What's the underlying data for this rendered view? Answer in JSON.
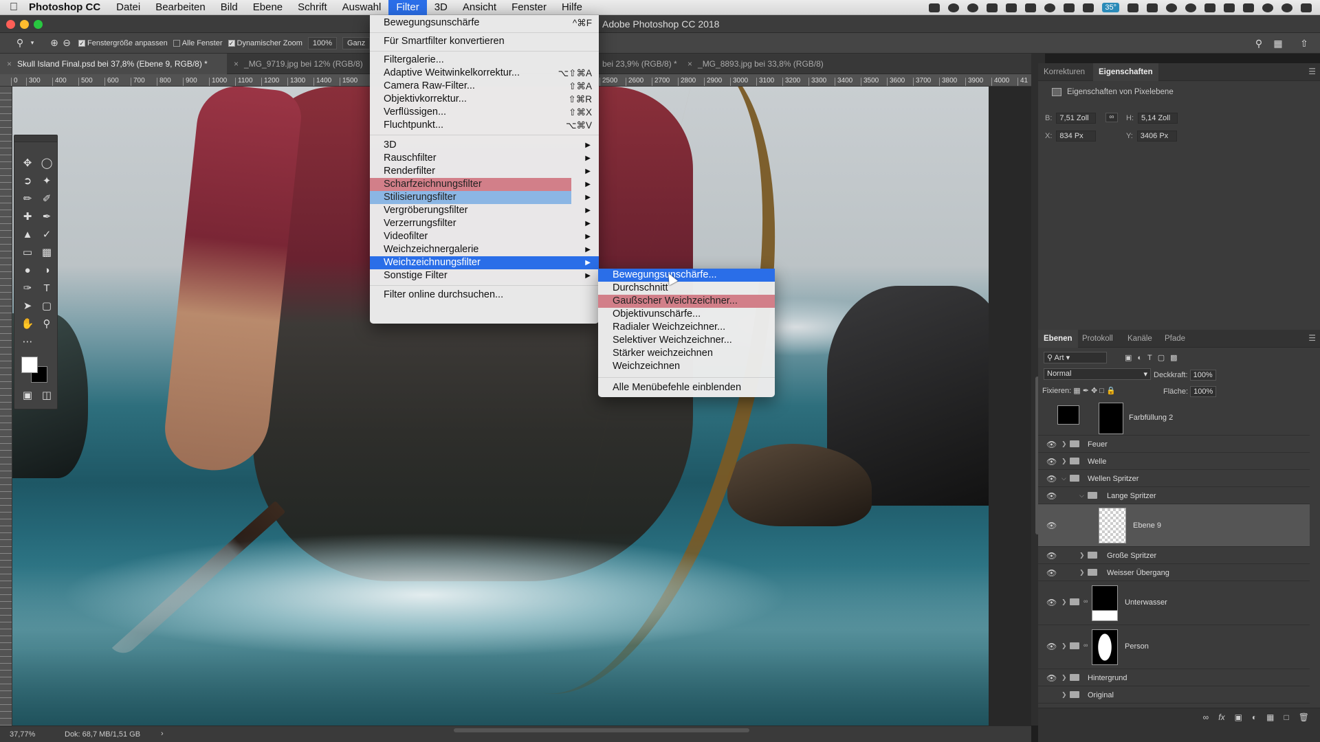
{
  "menubar": {
    "apple": "",
    "app_name": "Photoshop CC",
    "items": [
      "Datei",
      "Bearbeiten",
      "Bild",
      "Ebene",
      "Schrift",
      "Auswahl",
      "Filter",
      "3D",
      "Ansicht",
      "Fenster",
      "Hilfe"
    ],
    "active_item": "Filter",
    "tray_badge": "35°"
  },
  "window": {
    "title": "Adobe Photoshop CC 2018"
  },
  "options": {
    "fit_window": "Fenstergröße anpassen",
    "all_windows": "Alle Fenster",
    "dynamic_zoom": "Dynamischer Zoom",
    "zoom_value": "100%",
    "fit_screen": "Ganz"
  },
  "tabs": [
    {
      "label": "Skull Island Final.psd bei 37,8% (Ebene 9, RGB/8) *",
      "active": true
    },
    {
      "label": "_MG_9719.jpg bei 12% (RGB/8)",
      "active": false
    },
    {
      "label": "bei 23,9% (RGB/8) *",
      "active": false
    },
    {
      "label": "_MG_8893.jpg bei 33,8% (RGB/8)",
      "active": false
    }
  ],
  "ruler_top": [
    "0",
    "300",
    "400",
    "500",
    "600",
    "700",
    "800",
    "900",
    "1000",
    "1100",
    "1200",
    "1300",
    "1400",
    "1500",
    "2500",
    "2600",
    "2700",
    "2800",
    "2900",
    "3000",
    "3100",
    "3200",
    "3300",
    "3400",
    "3500",
    "3600",
    "3700",
    "3800",
    "3900",
    "4000",
    "41"
  ],
  "filter_menu": {
    "last_filter": {
      "label": "Bewegungsunschärfe",
      "shortcut": "^⌘F"
    },
    "convert_smart": "Für Smartfilter konvertieren",
    "group2": [
      {
        "label": "Filtergalerie...",
        "shortcut": ""
      },
      {
        "label": "Adaptive Weitwinkelkorrektur...",
        "shortcut": "⌥⇧⌘A"
      },
      {
        "label": "Camera Raw-Filter...",
        "shortcut": "⇧⌘A"
      },
      {
        "label": "Objektivkorrektur...",
        "shortcut": "⇧⌘R"
      },
      {
        "label": "Verflüssigen...",
        "shortcut": "⇧⌘X"
      },
      {
        "label": "Fluchtpunkt...",
        "shortcut": "⌥⌘V"
      }
    ],
    "submenus": [
      "3D",
      "Rauschfilter",
      "Renderfilter",
      "Scharfzeichnungsfilter",
      "Stilisierungsfilter",
      "Vergröberungsfilter",
      "Verzerrungsfilter",
      "Videofilter",
      "Weichzeichnergalerie",
      "Weichzeichnungsfilter",
      "Sonstige Filter"
    ],
    "browse_online": "Filter online durchsuchen..."
  },
  "blur_submenu": {
    "items": [
      "Bewegungsunschärfe...",
      "Durchschnitt",
      "Gaußscher Weichzeichner...",
      "Objektivunschärfe...",
      "Radialer Weichzeichner...",
      "Selektiver Weichzeichner...",
      "Stärker weichzeichnen",
      "Weichzeichnen"
    ],
    "show_all": "Alle Menübefehle einblenden"
  },
  "properties_panel": {
    "tabs": [
      "Korrekturen",
      "Eigenschaften"
    ],
    "header": "Eigenschaften von Pixelebene",
    "w_label": "B:",
    "w_value": "7,51 Zoll",
    "h_label": "H:",
    "h_value": "5,14 Zoll",
    "x_label": "X:",
    "x_value": "834 Px",
    "y_label": "Y:",
    "y_value": "3406 Px"
  },
  "layers_panel": {
    "tabs": [
      "Ebenen",
      "Protokoll",
      "Kanäle",
      "Pfade"
    ],
    "kind_filter": "Art",
    "blend_mode": "Normal",
    "opacity_label": "Deckkraft:",
    "opacity_value": "100%",
    "lock_label": "Fixieren:",
    "fill_label": "Fläche:",
    "fill_value": "100%",
    "layers": [
      {
        "name": "Farbfüllung 2"
      },
      {
        "name": "Feuer"
      },
      {
        "name": "Welle"
      },
      {
        "name": "Wellen Spritzer"
      },
      {
        "name": "Lange Spritzer"
      },
      {
        "name": "Ebene 9"
      },
      {
        "name": "Große Spritzer"
      },
      {
        "name": "Weisser Übergang"
      },
      {
        "name": "Unterwasser"
      },
      {
        "name": "Person"
      },
      {
        "name": "Hintergrund"
      },
      {
        "name": "Original"
      }
    ],
    "footer_icons": [
      "link-icon",
      "fx-icon",
      "mask-icon",
      "adjustment-icon",
      "group-icon",
      "new-layer-icon",
      "trash-icon"
    ]
  },
  "status": {
    "zoom": "37,77%",
    "doc": "Dok: 68,7 MB/1,51 GB",
    "arrow": "›"
  }
}
